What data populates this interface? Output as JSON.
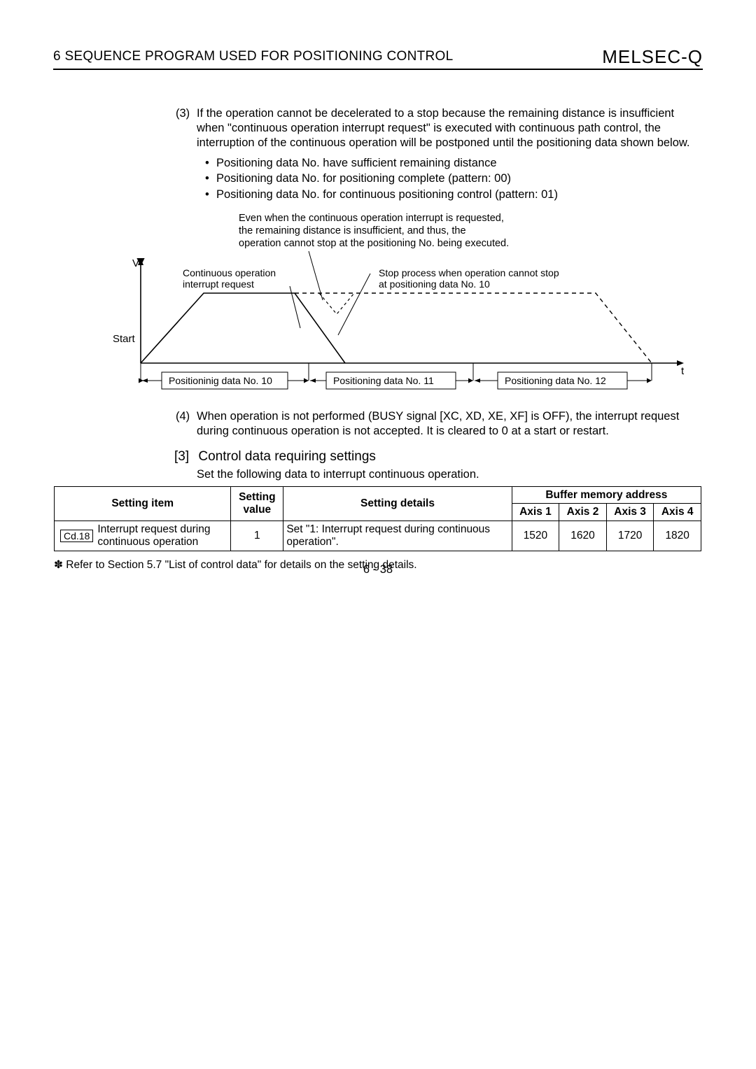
{
  "header": {
    "chapter": "6   SEQUENCE PROGRAM USED FOR POSITIONING CONTROL",
    "brand": "MELSEC-Q"
  },
  "para3": {
    "num": "(3)",
    "text": "If the operation cannot be decelerated to a stop because the remaining distance is insufficient when \"continuous operation interrupt request\" is executed with continuous path control, the interruption of the continuous operation will be postponed until the positioning data shown below."
  },
  "bullets3": [
    "Positioning data No. have sufficient remaining distance",
    "Positioning data No. for positioning complete (pattern: 00)",
    "Positioning data No. for continuous positioning control (pattern: 01)"
  ],
  "diagram": {
    "caption_l1": "Even when the continuous operation interrupt is requested,",
    "caption_l2": "the remaining distance is insufficient, and thus, the",
    "caption_l3": "operation cannot stop at the positioning No. being executed.",
    "v_label": "V",
    "t_label": "t",
    "start_label": "Start",
    "intr_l1": "Continuous operation",
    "intr_l2": "interrupt request",
    "stop_l1": "Stop process when operation cannot stop",
    "stop_l2": "at positioning data No. 10",
    "seg1": "Positioninig data No. 10",
    "seg2": "Positioning data No. 11",
    "seg3": "Positioning data No. 12"
  },
  "para4": {
    "num": "(4)",
    "text": "When operation is not performed (BUSY signal [XC, XD, XE, XF] is OFF), the interrupt request during continuous operation is not accepted. It is cleared to 0 at a start or restart."
  },
  "subhead": {
    "num": "[3]",
    "title": "Control data requiring settings"
  },
  "subdesc": "Set the following data to interrupt continuous operation.",
  "table": {
    "h_item": "Setting item",
    "h_val": "Setting value",
    "h_det": "Setting details",
    "h_buf": "Buffer memory address",
    "h_ax1": "Axis 1",
    "h_ax2": "Axis 2",
    "h_ax3": "Axis 3",
    "h_ax4": "Axis 4",
    "cd_code": "Cd.18",
    "cd_name": "Interrupt request during continuous operation",
    "cd_val": "1",
    "cd_det": "Set \"1: Interrupt request during continuous operation\".",
    "a1": "1520",
    "a2": "1620",
    "a3": "1720",
    "a4": "1820"
  },
  "footnote": "   Refer to Section 5.7 \"List of control data\" for details on the setting details.",
  "foot_sym": "✽",
  "pgnum": "6 - 38"
}
